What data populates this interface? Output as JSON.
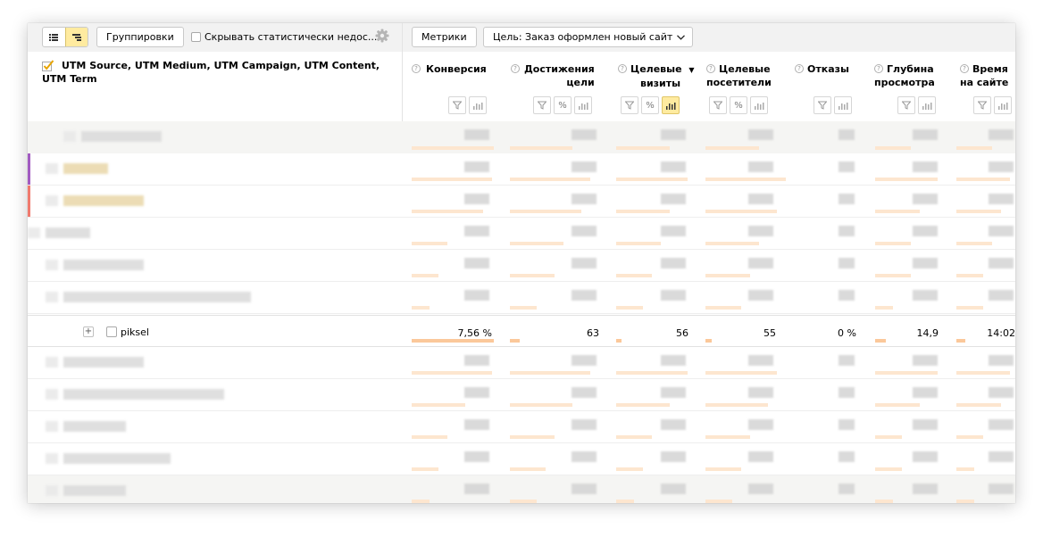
{
  "toolbar": {
    "groupings_label": "Группировки",
    "hide_stat_label": "Скрывать статистически недос...",
    "metrics_label": "Метрики",
    "goal_label": "Цель: Заказ оформлен новый сайт"
  },
  "table": {
    "dimension_header": "UTM Source, UTM Medium, UTM Campaign, UTM Content, UTM Term",
    "columns": [
      {
        "line1": "Конверсия",
        "line2": ""
      },
      {
        "line1": "Достижения",
        "line2": "цели"
      },
      {
        "line1": "Целевые",
        "line2": "визиты"
      },
      {
        "line1": "Целевые",
        "line2": "посетители"
      },
      {
        "line1": "Отказы",
        "line2": ""
      },
      {
        "line1": "Глубина",
        "line2": "просмотра"
      },
      {
        "line1": "Время",
        "line2": "на сайте"
      }
    ],
    "sort_indicator": "▼",
    "piksel_row": {
      "label": "piksel",
      "values": [
        "7,56 %",
        "63",
        "56",
        "55",
        "0 %",
        "14,9",
        "14:02"
      ],
      "bar_levels": [
        1.0,
        0.12,
        0.08,
        0.08,
        0,
        0.16,
        0.15
      ]
    },
    "accent_colors": [
      "#a25bc2",
      "#f07a6e"
    ],
    "bar_color": "#fde6cf",
    "sort_active_color": "#ffeba0"
  }
}
